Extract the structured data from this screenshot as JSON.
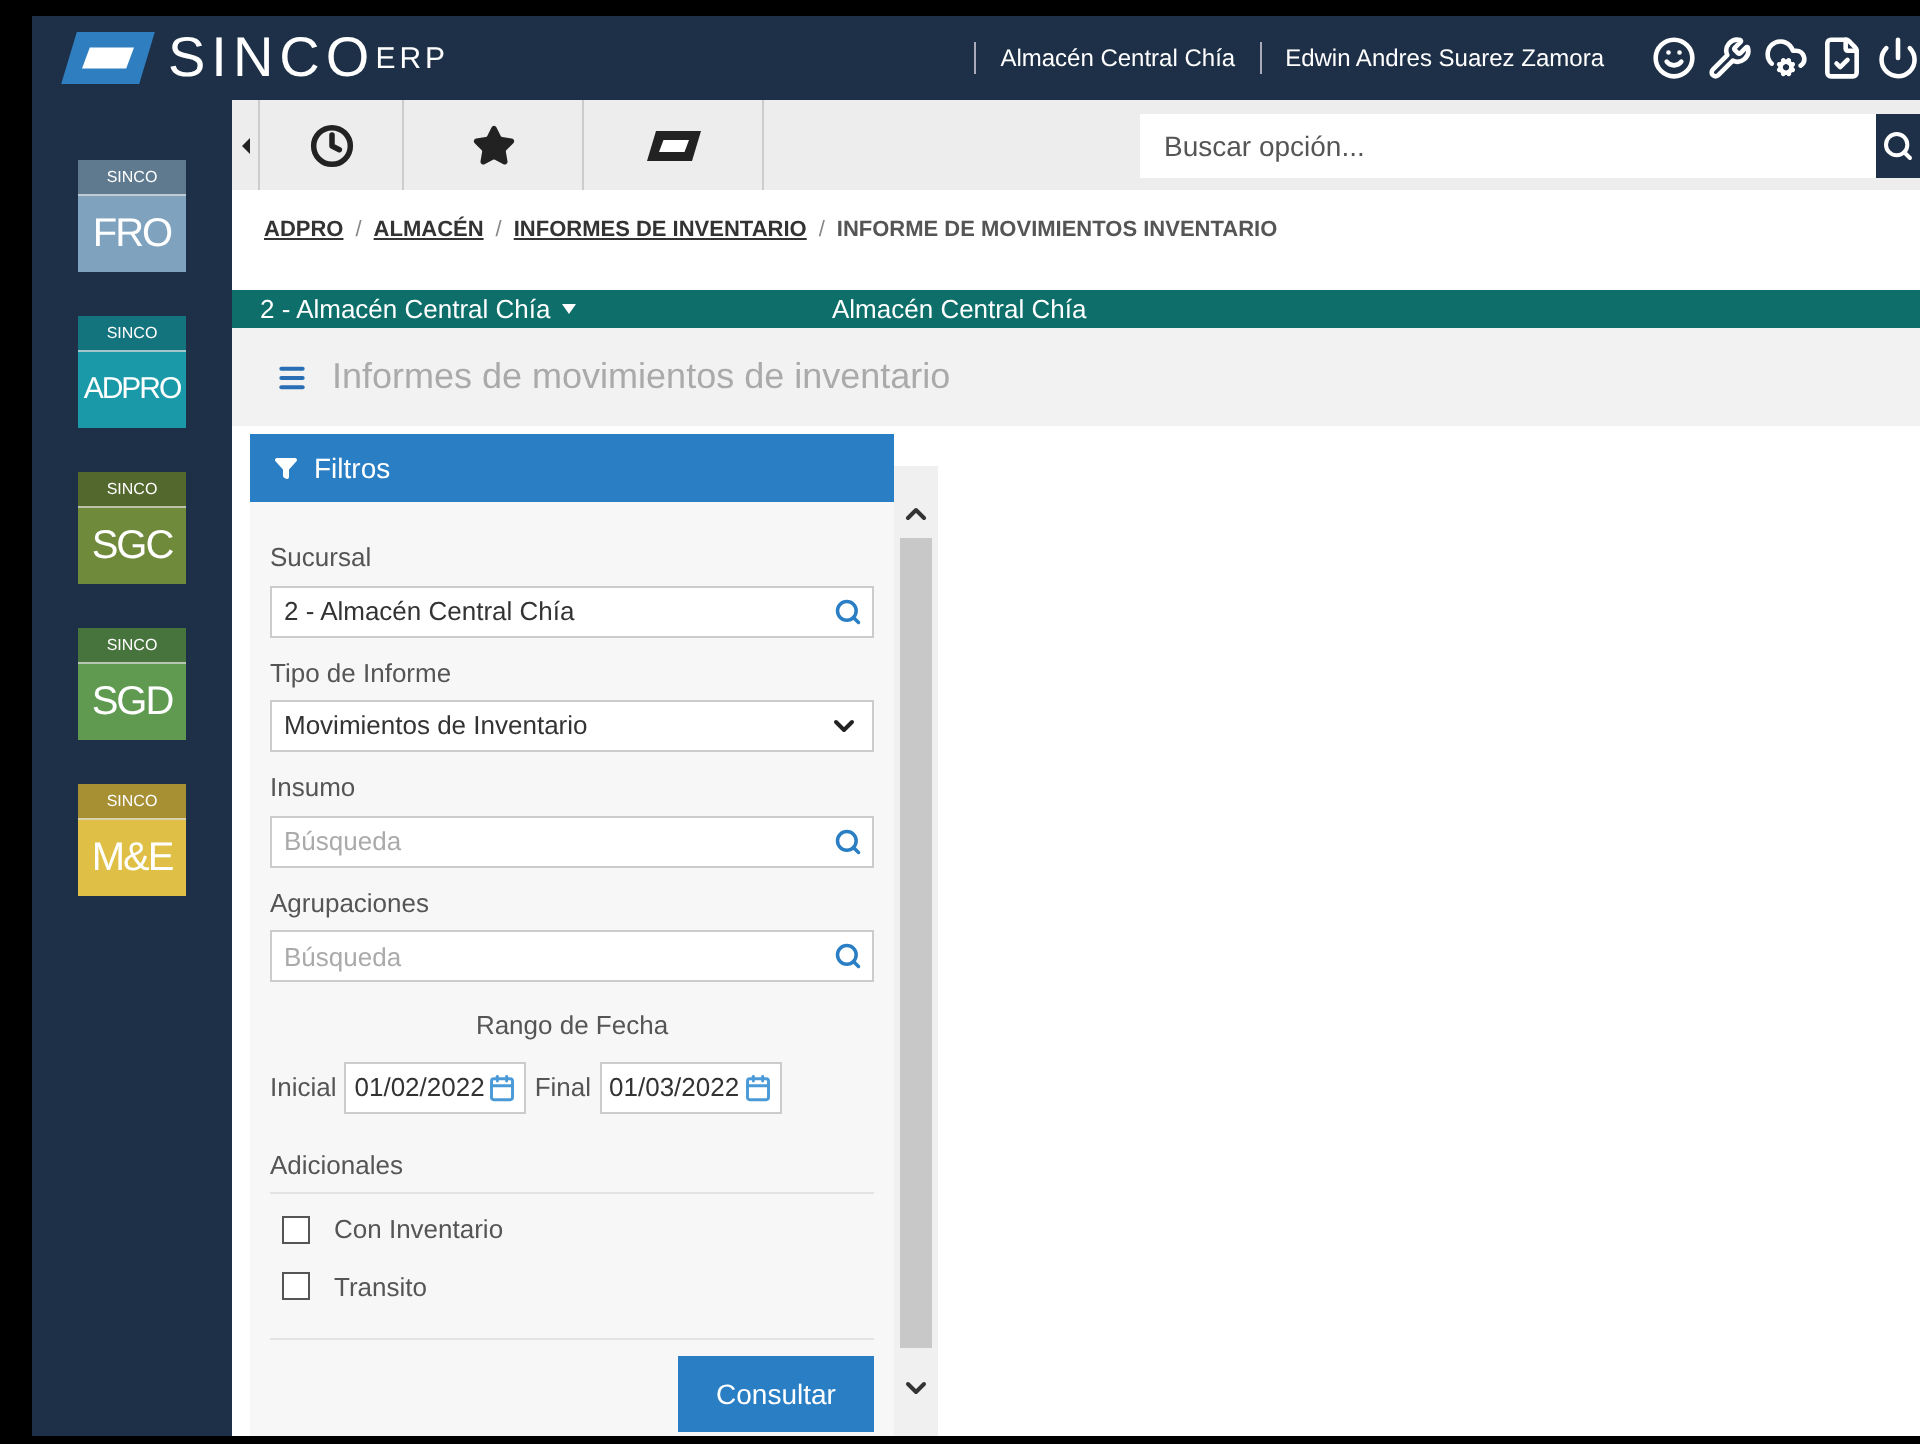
{
  "header": {
    "logo": "SINCO",
    "logo_suffix": "ERP",
    "location": "Almacén Central Chía",
    "user": "Edwin Andres Suarez Zamora"
  },
  "modules": [
    {
      "top": "SINCO",
      "name": "FRO",
      "color": "#7fa3bf"
    },
    {
      "top": "SINCO",
      "name": "ADPRO",
      "color": "#1a9aa8"
    },
    {
      "top": "SINCO",
      "name": "SGC",
      "color": "#6f8a3a"
    },
    {
      "top": "SINCO",
      "name": "SGD",
      "color": "#5f9a50"
    },
    {
      "top": "SINCO",
      "name": "M&E",
      "color": "#dfbf45"
    }
  ],
  "toolbar": {
    "search": {
      "placeholder": "Buscar opción..."
    }
  },
  "breadcrumb_separator": "/",
  "breadcrumb": [
    {
      "label": "ADPRO",
      "kind": "link"
    },
    {
      "label": "ALMACÉN",
      "kind": "link"
    },
    {
      "label": "INFORMES DE INVENTARIO",
      "kind": "link"
    },
    {
      "label": "INFORME DE MOVIMIENTOS INVENTARIO",
      "kind": "current"
    }
  ],
  "branch_bar": {
    "branch": "2 - Almacén Central Chía",
    "location": "Almacén Central Chía"
  },
  "page_title": "Informes de movimientos de inventario",
  "filters": {
    "title": "Filtros",
    "fields": [
      {
        "label": "Sucursal",
        "kind": "search",
        "value": "2 - Almacén Central Chía"
      },
      {
        "label": "Tipo de Informe",
        "kind": "select",
        "value": "Movimientos de Inventario"
      },
      {
        "label": "Insumo",
        "kind": "search",
        "placeholder": "Búsqueda"
      },
      {
        "label": "Agrupaciones",
        "kind": "search",
        "placeholder": "Búsqueda"
      }
    ],
    "date_range": {
      "title": "Rango de Fecha",
      "start_label": "Inicial",
      "start": "01/02/2022",
      "end_label": "Final",
      "end": "01/03/2022"
    },
    "extras_title": "Adicionales",
    "checkboxes": [
      {
        "label": "Con Inventario",
        "checked": false
      },
      {
        "label": "Transito",
        "checked": false
      }
    ],
    "submit": "Consultar"
  }
}
